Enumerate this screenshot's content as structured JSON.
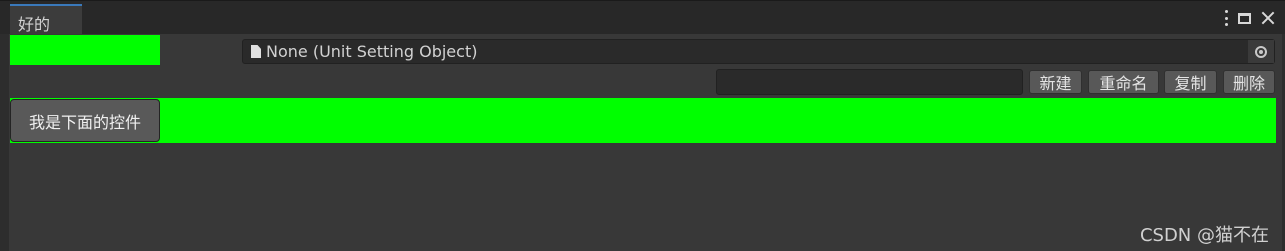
{
  "window": {
    "tab_title": "好的"
  },
  "object_field": {
    "label": "None (Unit Setting Object)"
  },
  "toolbar": {
    "input_value": "",
    "new_label": "新建",
    "rename_label": "重命名",
    "copy_label": "复制",
    "delete_label": "删除"
  },
  "control": {
    "button_label": "我是下面的控件"
  },
  "watermark": "CSDN @猫不在",
  "colors": {
    "highlight_green": "#00ff00",
    "tab_accent": "#3a79bb",
    "background": "#383838"
  }
}
